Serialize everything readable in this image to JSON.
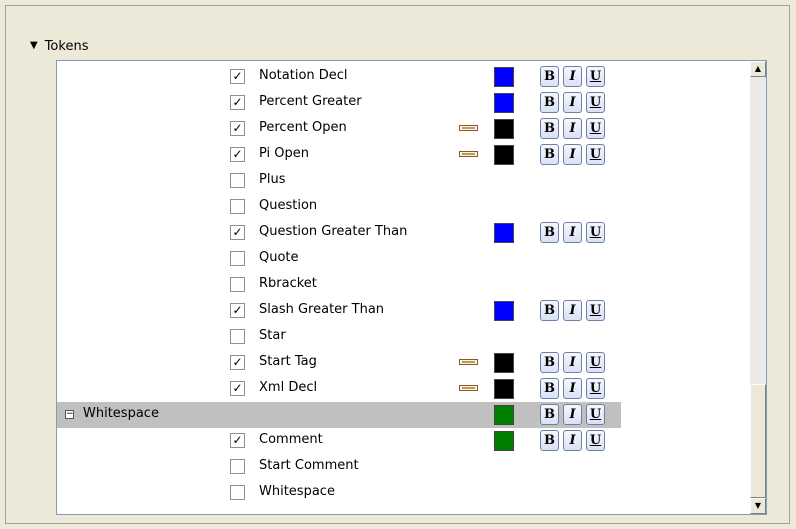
{
  "section": {
    "title": "Tokens",
    "expand_icon": "triangle-down-icon"
  },
  "items": [
    {
      "label": "Notation Decl",
      "checked": true,
      "color": "#0000ff",
      "has_pencil": false,
      "has_format": true
    },
    {
      "label": "Percent Greater",
      "checked": true,
      "color": "#0000ff",
      "has_pencil": false,
      "has_format": true
    },
    {
      "label": "Percent Open",
      "checked": true,
      "color": "#000000",
      "has_pencil": true,
      "has_format": true
    },
    {
      "label": "Pi Open",
      "checked": true,
      "color": "#000000",
      "has_pencil": true,
      "has_format": true
    },
    {
      "label": "Plus",
      "checked": false,
      "color": null,
      "has_pencil": false,
      "has_format": false
    },
    {
      "label": "Question",
      "checked": false,
      "color": null,
      "has_pencil": false,
      "has_format": false
    },
    {
      "label": "Question Greater Than",
      "checked": true,
      "color": "#0000ff",
      "has_pencil": false,
      "has_format": true
    },
    {
      "label": "Quote",
      "checked": false,
      "color": null,
      "has_pencil": false,
      "has_format": false
    },
    {
      "label": "Rbracket",
      "checked": false,
      "color": null,
      "has_pencil": false,
      "has_format": false
    },
    {
      "label": "Slash Greater Than",
      "checked": true,
      "color": "#0000ff",
      "has_pencil": false,
      "has_format": true
    },
    {
      "label": "Star",
      "checked": false,
      "color": null,
      "has_pencil": false,
      "has_format": false
    },
    {
      "label": "Start Tag",
      "checked": true,
      "color": "#000000",
      "has_pencil": true,
      "has_format": true
    },
    {
      "label": "Xml Decl",
      "checked": true,
      "color": "#000000",
      "has_pencil": true,
      "has_format": true
    },
    {
      "group": true,
      "label": "Whitespace",
      "expander": "⊟",
      "color": "#008000",
      "has_format": true
    },
    {
      "label": "Comment",
      "checked": true,
      "color": "#008000",
      "has_pencil": false,
      "has_format": true
    },
    {
      "label": "Start Comment",
      "checked": false,
      "color": null,
      "has_pencil": false,
      "has_format": false
    },
    {
      "label": "Whitespace",
      "checked": false,
      "color": null,
      "has_pencil": false,
      "has_format": false
    }
  ],
  "format_buttons": {
    "bold": "B",
    "italic": "I",
    "underline": "U"
  },
  "check_glyph": "✓",
  "icons": {
    "edit": "pencil-icon",
    "scroll_up": "arrow-up-icon",
    "scroll_down": "arrow-down-icon"
  }
}
